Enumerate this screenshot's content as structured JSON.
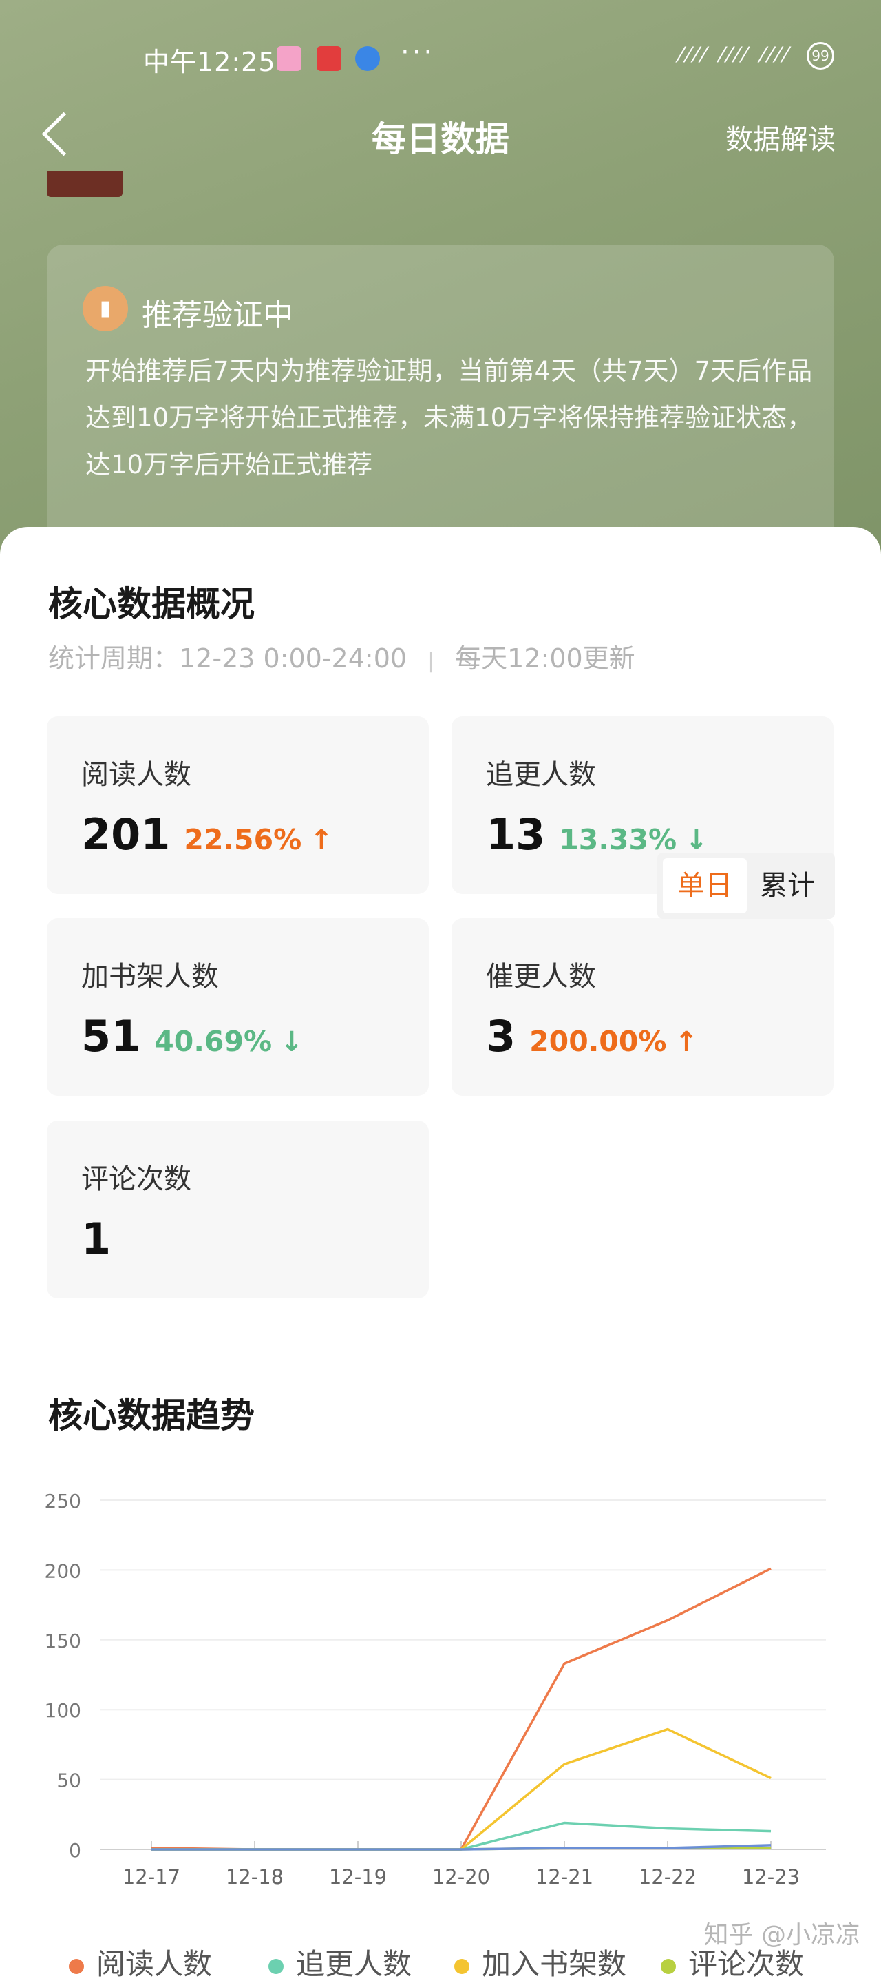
{
  "status_bar": {
    "time": "中午12:25",
    "more": "···",
    "signal": "⁄⁄⁄⁄ ⁄⁄⁄⁄ ⁄⁄⁄⁄",
    "battery": "99"
  },
  "nav": {
    "title": "每日数据",
    "action": "数据解读"
  },
  "recommend": {
    "title": "推荐验证中",
    "body": "开始推荐后7天内为推荐验证期，当前第4天（共7天）7天后作品达到10万字将开始正式推荐，未满10万字将保持推荐验证状态，达10万字后开始正式推荐"
  },
  "core_overview": {
    "title": "核心数据概况",
    "period": "统计周期：12-23 0:00-24:00",
    "update": "每天12:00更新",
    "metrics": [
      {
        "label": "阅读人数",
        "value": "201",
        "change": "22.56%",
        "arrow": "↑",
        "direction": "up"
      },
      {
        "label": "追更人数",
        "value": "13",
        "change": "13.33%",
        "arrow": "↓",
        "direction": "down"
      },
      {
        "label": "加书架人数",
        "value": "51",
        "change": "40.69%",
        "arrow": "↓",
        "direction": "down"
      },
      {
        "label": "催更人数",
        "value": "3",
        "change": "200.00%",
        "arrow": "↑",
        "direction": "up"
      },
      {
        "label": "评论次数",
        "value": "1",
        "change": "",
        "arrow": "",
        "direction": ""
      }
    ]
  },
  "core_trend": {
    "title": "核心数据趋势",
    "toggle": {
      "active": "单日",
      "inactive": "累计"
    }
  },
  "chart_data": {
    "type": "line",
    "title": "",
    "categories": [
      "12-17",
      "12-18",
      "12-19",
      "12-20",
      "12-21",
      "12-22",
      "12-23"
    ],
    "ylim": [
      0,
      250
    ],
    "yticks": [
      0,
      50,
      100,
      150,
      200,
      250
    ],
    "grid": true,
    "series": [
      {
        "name": "阅读人数",
        "color": "#ee7a4a",
        "values": [
          1,
          0,
          0,
          0,
          133,
          164,
          201
        ]
      },
      {
        "name": "追更人数",
        "color": "#6cd0b0",
        "values": [
          0,
          0,
          0,
          0,
          19,
          15,
          13
        ]
      },
      {
        "name": "加入书架数",
        "color": "#f4c430",
        "values": [
          0,
          0,
          0,
          0,
          61,
          86,
          51
        ]
      },
      {
        "name": "评论次数",
        "color": "#b8d040",
        "values": [
          0,
          0,
          0,
          0,
          1,
          1,
          1
        ]
      },
      {
        "name": "",
        "color": "#6b8fd6",
        "values": [
          0,
          0,
          0,
          0,
          1,
          1,
          3
        ]
      }
    ]
  },
  "watermark": "知乎 @小凉凉"
}
